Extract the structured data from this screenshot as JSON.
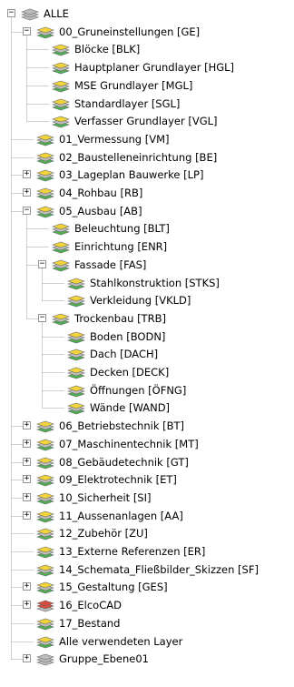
{
  "tree": {
    "root_label": "ALLE",
    "nodes": [
      {
        "label": "ALLE",
        "level": 0,
        "toggle": "minus",
        "icon": "layers-stack"
      },
      {
        "label": "00_Gruneinstellungen [GE]",
        "level": 1,
        "toggle": "minus",
        "icon": "layer-group"
      },
      {
        "label": "Blöcke [BLK]",
        "level": 2,
        "toggle": "",
        "icon": "layer-group"
      },
      {
        "label": "Hauptplaner Grundlayer [HGL]",
        "level": 2,
        "toggle": "",
        "icon": "layer-group"
      },
      {
        "label": "MSE Grundlayer [MGL]",
        "level": 2,
        "toggle": "",
        "icon": "layer-group"
      },
      {
        "label": "Standardlayer [SGL]",
        "level": 2,
        "toggle": "",
        "icon": "layer-group"
      },
      {
        "label": "Verfasser Grundlayer [VGL]",
        "level": 2,
        "toggle": "",
        "icon": "layer-group"
      },
      {
        "label": "01_Vermessung [VM]",
        "level": 1,
        "toggle": "",
        "icon": "layer-group"
      },
      {
        "label": "02_Baustelleneinrichtung [BE]",
        "level": 1,
        "toggle": "",
        "icon": "layer-group"
      },
      {
        "label": "03_Lageplan Bauwerke [LP]",
        "level": 1,
        "toggle": "plus",
        "icon": "layer-group"
      },
      {
        "label": "04_Rohbau [RB]",
        "level": 1,
        "toggle": "plus",
        "icon": "layer-group"
      },
      {
        "label": "05_Ausbau [AB]",
        "level": 1,
        "toggle": "minus",
        "icon": "layer-group"
      },
      {
        "label": "Beleuchtung [BLT]",
        "level": 2,
        "toggle": "",
        "icon": "layer-group"
      },
      {
        "label": "Einrichtung [ENR]",
        "level": 2,
        "toggle": "",
        "icon": "layer-group"
      },
      {
        "label": "Fassade [FAS]",
        "level": 2,
        "toggle": "minus",
        "icon": "layer-group"
      },
      {
        "label": "Stahlkonstruktion [STKS]",
        "level": 3,
        "toggle": "",
        "icon": "layer-group"
      },
      {
        "label": "Verkleidung [VKLD]",
        "level": 3,
        "toggle": "",
        "icon": "layer-group"
      },
      {
        "label": "Trockenbau [TRB]",
        "level": 2,
        "toggle": "minus",
        "icon": "layer-group"
      },
      {
        "label": "Boden [BODN]",
        "level": 3,
        "toggle": "",
        "icon": "layer-group"
      },
      {
        "label": "Dach [DACH]",
        "level": 3,
        "toggle": "",
        "icon": "layer-group"
      },
      {
        "label": "Decken [DECK]",
        "level": 3,
        "toggle": "",
        "icon": "layer-group"
      },
      {
        "label": "Öffnungen [ÖFNG]",
        "level": 3,
        "toggle": "",
        "icon": "layer-group"
      },
      {
        "label": "Wände [WAND]",
        "level": 3,
        "toggle": "",
        "icon": "layer-group"
      },
      {
        "label": "06_Betriebstechnik [BT]",
        "level": 1,
        "toggle": "plus",
        "icon": "layer-group"
      },
      {
        "label": "07_Maschinentechnik [MT]",
        "level": 1,
        "toggle": "plus",
        "icon": "layer-group"
      },
      {
        "label": "08_Gebäudetechnik [GT]",
        "level": 1,
        "toggle": "plus",
        "icon": "layer-group"
      },
      {
        "label": "09_Elektrotechnik [ET]",
        "level": 1,
        "toggle": "plus",
        "icon": "layer-group"
      },
      {
        "label": "10_Sicherheit [SI]",
        "level": 1,
        "toggle": "plus",
        "icon": "layer-group"
      },
      {
        "label": "11_Aussenanlagen [AA]",
        "level": 1,
        "toggle": "plus",
        "icon": "layer-group"
      },
      {
        "label": "12_Zubehör [ZU]",
        "level": 1,
        "toggle": "",
        "icon": "layer-group"
      },
      {
        "label": "13_Externe Referenzen [ER]",
        "level": 1,
        "toggle": "",
        "icon": "layer-group"
      },
      {
        "label": "14_Schemata_Fließbilder_Skizzen [SF]",
        "level": 1,
        "toggle": "",
        "icon": "layer-group"
      },
      {
        "label": "15_Gestaltung [GES]",
        "level": 1,
        "toggle": "plus",
        "icon": "layer-group"
      },
      {
        "label": "16_ElcoCAD",
        "level": 1,
        "toggle": "plus",
        "icon": "layer-group-red"
      },
      {
        "label": "17_Bestand",
        "level": 1,
        "toggle": "",
        "icon": "layer-group"
      },
      {
        "label": "Alle verwendeten Layer",
        "level": 1,
        "toggle": "",
        "icon": "layer-group"
      },
      {
        "label": "Gruppe_Ebene01",
        "level": 1,
        "toggle": "plus",
        "icon": "layers-stack"
      }
    ]
  },
  "colors": {
    "connector": "#a0a0a0",
    "toggle_border": "#949494",
    "icon_yellow": "#f2d33a",
    "icon_green": "#4caf50",
    "icon_gray": "#bdbdbd",
    "icon_red": "#d84a3a"
  }
}
